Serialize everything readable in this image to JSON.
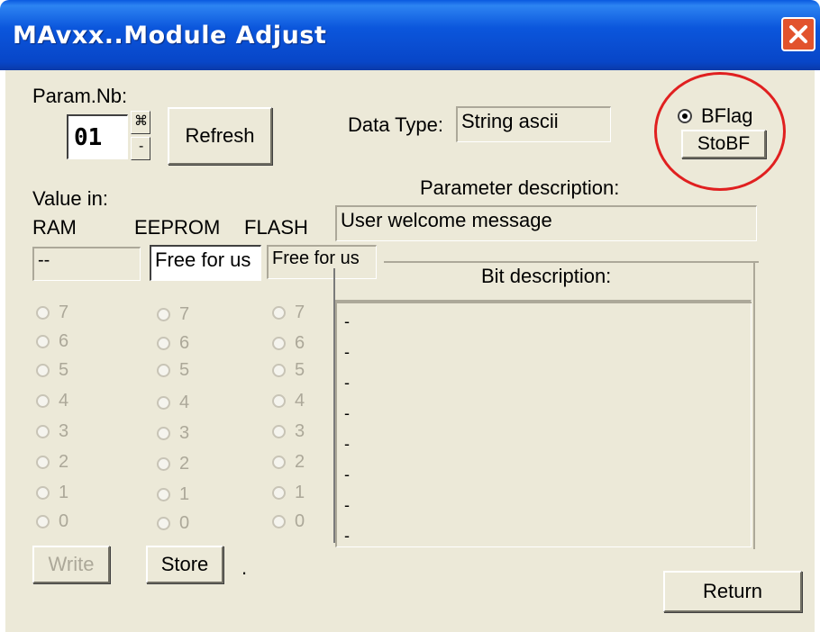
{
  "window": {
    "title": "MAvxx..Module Adjust"
  },
  "param": {
    "label": "Param.Nb:",
    "value": "01",
    "up_glyph": "⌘",
    "down_glyph": "-"
  },
  "refresh_label": "Refresh",
  "data_type": {
    "label": "Data Type:",
    "value": "String ascii"
  },
  "bflag": {
    "radio_label": "BFlag",
    "button_label": "StoBF"
  },
  "param_desc": {
    "label": "Parameter description:",
    "value": "User welcome message"
  },
  "value_in": {
    "label": "Value in:",
    "ram": "RAM",
    "eeprom": "EEPROM",
    "flash": "FLASH"
  },
  "fields": {
    "ram": "--",
    "eeprom": "Free for us",
    "flash": "Free for us"
  },
  "bits": [
    "7",
    "6",
    "5",
    "4",
    "3",
    "2",
    "1",
    "0"
  ],
  "bit_description": {
    "label": "Bit description:",
    "items": [
      "-",
      "-",
      "-",
      "-",
      "-",
      "-",
      "-",
      "-"
    ]
  },
  "write_label": "Write",
  "store_label": "Store",
  "status_dot": ".",
  "return_label": "Return",
  "colors": {
    "title_bar": "#0a56dc",
    "face": "#ece9d8",
    "highlight_circle": "#e02020",
    "close": "#e2532d"
  }
}
